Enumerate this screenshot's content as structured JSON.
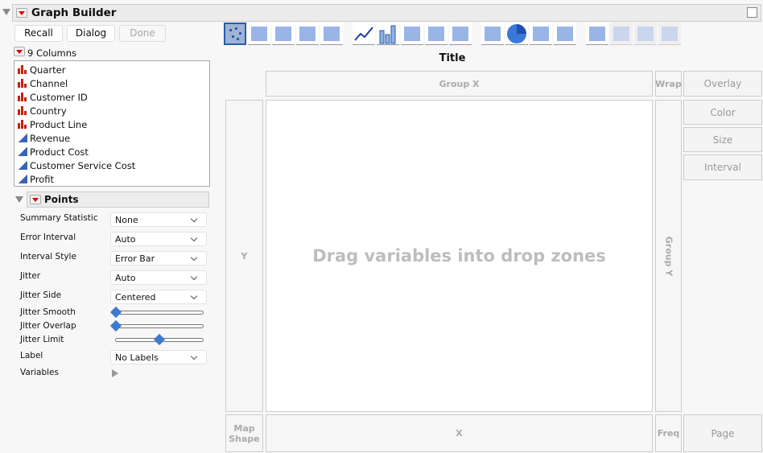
{
  "window": {
    "title": "Graph Builder"
  },
  "buttons": {
    "recall": "Recall",
    "dialog": "Dialog",
    "done": "Done"
  },
  "columns": {
    "header": "9 Columns",
    "items": [
      {
        "name": "Quarter",
        "type": "nominal"
      },
      {
        "name": "Channel",
        "type": "nominal"
      },
      {
        "name": "Customer ID",
        "type": "nominal"
      },
      {
        "name": "Country",
        "type": "nominal"
      },
      {
        "name": "Product Line",
        "type": "nominal"
      },
      {
        "name": "Revenue",
        "type": "continuous"
      },
      {
        "name": "Product Cost",
        "type": "continuous"
      },
      {
        "name": "Customer Service Cost",
        "type": "continuous"
      },
      {
        "name": "Profit",
        "type": "continuous"
      }
    ]
  },
  "points": {
    "title": "Points",
    "summary_statistic": {
      "label": "Summary Statistic",
      "value": "None"
    },
    "error_interval": {
      "label": "Error Interval",
      "value": "Auto"
    },
    "interval_style": {
      "label": "Interval Style",
      "value": "Error Bar"
    },
    "jitter": {
      "label": "Jitter",
      "value": "Auto"
    },
    "jitter_side": {
      "label": "Jitter Side",
      "value": "Centered"
    },
    "jitter_smooth": {
      "label": "Jitter Smooth",
      "value": 0
    },
    "jitter_overlap": {
      "label": "Jitter Overlap",
      "value": 0
    },
    "jitter_limit": {
      "label": "Jitter Limit",
      "value": 0.5
    },
    "label": {
      "label": "Label",
      "value": "No Labels"
    },
    "variables": {
      "label": "Variables"
    }
  },
  "toolbar": [
    "points",
    "smoother",
    "line-of-fit",
    "ellipse",
    "contour",
    "line",
    "bar",
    "area",
    "box-plot",
    "histogram",
    "heatmap",
    "pie",
    "treemap",
    "mosaic",
    "caption-box",
    "formula",
    "map-shapes",
    "parallel"
  ],
  "graph": {
    "title": "Title",
    "placeholder": "Drag variables into drop zones",
    "zones": {
      "group_x": "Group X",
      "wrap": "Wrap",
      "overlay": "Overlay",
      "color": "Color",
      "size": "Size",
      "interval": "Interval",
      "y": "Y",
      "group_y": "Group Y",
      "map_shape": "Map Shape",
      "x": "X",
      "freq": "Freq",
      "page": "Page"
    }
  }
}
